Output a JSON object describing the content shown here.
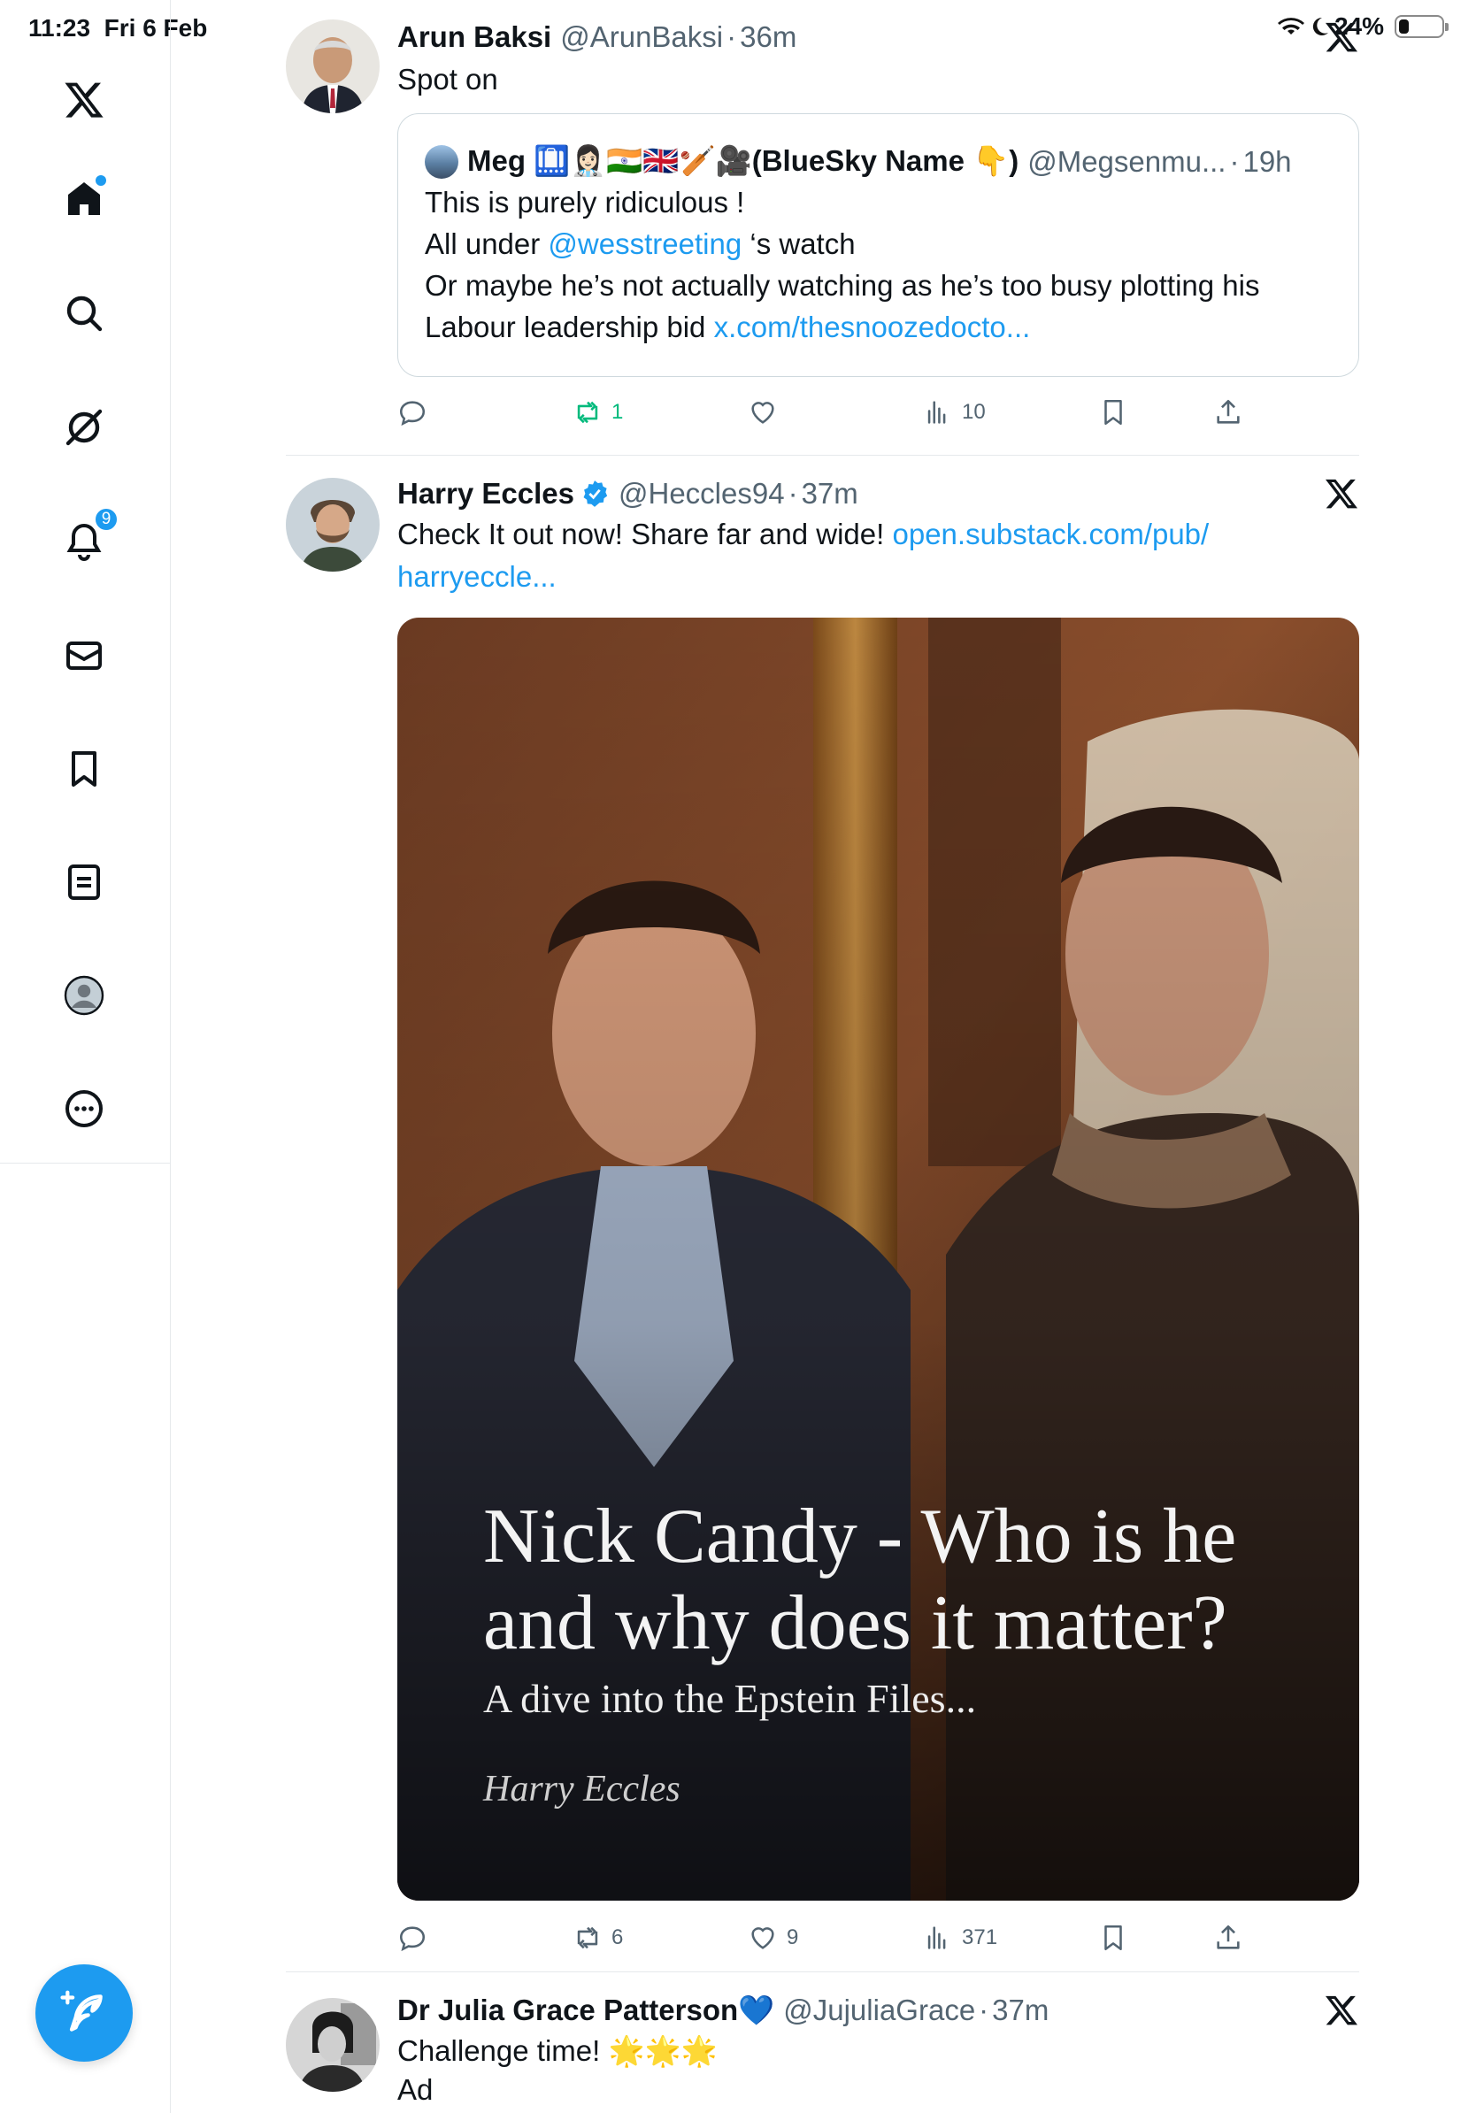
{
  "status_bar": {
    "time": "11:23",
    "date": "Fri 6 Feb",
    "battery": "24%",
    "battery_level": 0.24
  },
  "sidebar": {
    "notifications_badge": "9",
    "accent_color": "#1d9bf0"
  },
  "posts": [
    {
      "name": "Arun Baksi",
      "handle": "@ArunBaksi",
      "time": "36m",
      "text": "Spot on",
      "quote": {
        "name": "Meg 🛄👩🏻‍⚕️🇮🇳🇬🇧🏏🎥(BlueSky Name 👇)",
        "handle": "@Megsenmu...",
        "time": "19h",
        "line1": "This is purely ridiculous !",
        "line2_pre": "All under ",
        "line2_mention": "@wesstreeting",
        "line2_post": " ‘s watch",
        "line3": "Or maybe he’s not actually watching as he’s too busy plotting his",
        "line4_pre": "Labour leadership bid ",
        "line4_link": "x.com/thesnoozedocto..."
      },
      "stats": {
        "replies": "",
        "reposts": "1",
        "likes": "",
        "views": "10"
      }
    },
    {
      "name": "Harry Eccles",
      "handle": "@Heccles94",
      "time": "37m",
      "text_pre": "Check It out now! Share far and wide! ",
      "link_part1": "open.substack.com/pub/",
      "link_part2": "harryeccle...",
      "card": {
        "title": "Nick Candy - Who is he and why does it matter?",
        "subtitle": "A dive into the Epstein Files...",
        "author": "Harry Eccles"
      },
      "stats": {
        "replies": "",
        "reposts": "6",
        "likes": "9",
        "views": "371"
      }
    },
    {
      "name": "Dr Julia Grace Patterson💙",
      "handle": "@JujuliaGrace",
      "time": "37m",
      "text": "Challenge time! 🌟🌟🌟",
      "label": "Ad"
    }
  ]
}
